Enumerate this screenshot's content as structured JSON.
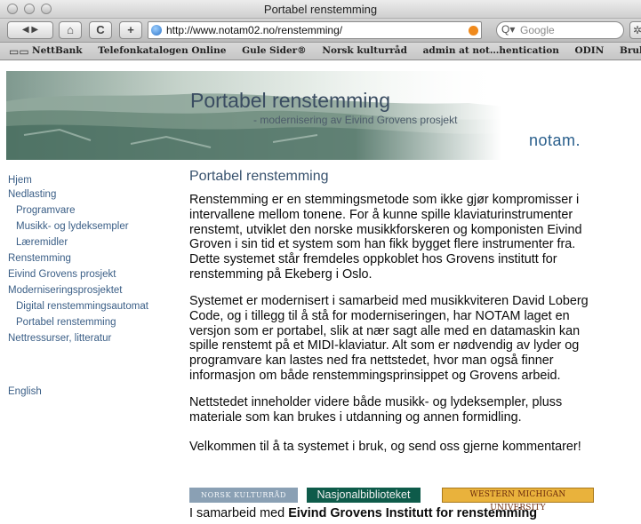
{
  "window": {
    "title": "Portabel renstemming"
  },
  "toolbar": {
    "back_forward": "◀ ▶",
    "home_glyph": "⌂",
    "reload_glyph": "C",
    "add_glyph": "+",
    "url": "http://www.notam02.no/renstemming/",
    "search_placeholder": "Google",
    "search_icon": "search-icon",
    "gear_icon": "gear-icon"
  },
  "bookmarks": [
    "NettBank",
    "Telefonkatalogen Online",
    "Gule Sider®",
    "Norsk kulturråd",
    "admin at not…hentication",
    "ODIN",
    "Brukerdatabase"
  ],
  "banner": {
    "title": "Portabel renstemming",
    "subtitle": "- modernisering av Eivind Grovens prosjekt",
    "logo": "notam."
  },
  "sidebar": {
    "items": [
      {
        "label": "Hjem",
        "sub": false
      },
      {
        "label": "Nedlasting",
        "sub": false
      },
      {
        "label": "Programvare",
        "sub": true
      },
      {
        "label": "Musikk- og lydeksempler",
        "sub": true
      },
      {
        "label": "Læremidler",
        "sub": true
      },
      {
        "label": "Renstemming",
        "sub": false
      },
      {
        "label": "Eivind Grovens prosjekt",
        "sub": false
      },
      {
        "label": "Moderniseringsprosjektet",
        "sub": false
      },
      {
        "label": "Digital renstemmingsautomat",
        "sub": true
      },
      {
        "label": "Portabel renstemming",
        "sub": true
      },
      {
        "label": "Nettressurser, litteratur",
        "sub": false
      }
    ],
    "english": "English"
  },
  "content": {
    "title": "Portabel renstemming",
    "paragraphs": [
      [
        "Renstemming er en stemmingsmetode som ikke gjør kompromisser i",
        "intervallene mellom tonene. For å kunne spille klaviaturinstrumenter",
        "renstemt, utviklet den norske musikkforskeren og komponisten Eivind",
        "Groven i sin tid et system som han fikk bygget flere instrumenter fra.",
        "Dette systemet står fremdeles oppkoblet hos Grovens institutt for",
        "renstemming på Ekeberg i Oslo."
      ],
      [
        "Systemet er modernisert i samarbeid med musikkviteren David Loberg",
        "Code, og i tillegg til å stå for moderniseringen, har NOTAM laget en",
        "versjon som er portabel, slik at nær sagt alle med en datamaskin kan",
        "spille renstemt på et MIDI-klaviatur. Alt som er nødvendig av lyder og",
        "programvare kan lastes ned fra nettstedet, hvor man også finner",
        "informasjon om både renstemmingsprinsippet og Grovens arbeid."
      ],
      [
        "Nettstedet inneholder videre både musikk- og lydeksempler, pluss",
        "materiale som kan brukes i utdanning og annen formidling."
      ],
      [
        "Velkommen til å ta systemet i bruk, og send oss gjerne kommentarer!"
      ]
    ]
  },
  "footer": {
    "logo_kulturrad": "NORSK KULTURRÅD",
    "logo_nb": "Nasjonalbiblioteket",
    "logo_wmu": "WESTERN MICHIGAN UNIVERSITY",
    "collab_prefix": "I samarbeid med ",
    "collab_bold": "Eivind Grovens Institutt for renstemming"
  }
}
